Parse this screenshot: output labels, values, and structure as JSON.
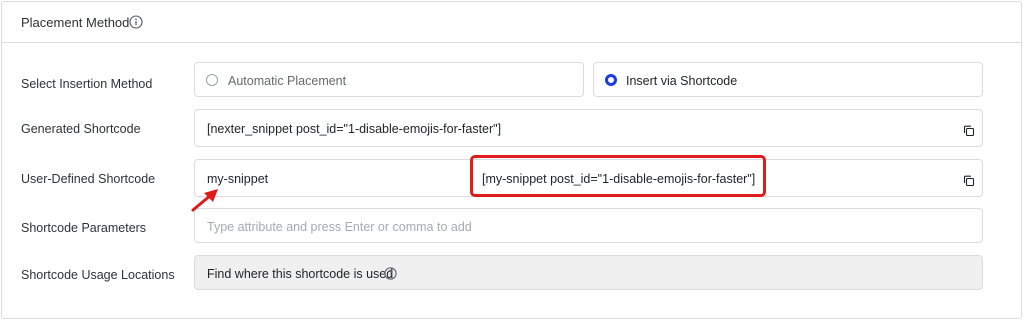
{
  "header": {
    "title": "Placement Method",
    "info_icon": "info-circle-icon"
  },
  "rows": {
    "insertion": {
      "label": "Select Insertion Method",
      "options": [
        {
          "label": "Automatic Placement",
          "selected": false
        },
        {
          "label": "Insert via Shortcode",
          "selected": true
        }
      ]
    },
    "generated": {
      "label": "Generated Shortcode",
      "value": "[nexter_snippet post_id=\"1-disable-emojis-for-faster\"]",
      "copy_icon": "copy-icon"
    },
    "user_defined": {
      "label": "User-Defined Shortcode",
      "value": "my-snippet",
      "preview": "[my-snippet post_id=\"1-disable-emojis-for-faster\"]",
      "copy_icon": "copy-icon"
    },
    "parameters": {
      "label": "Shortcode Parameters",
      "placeholder": "Type attribute and press Enter or comma to add",
      "value": ""
    },
    "usage": {
      "label": "Shortcode Usage Locations",
      "button_label": "Find where this shortcode is used",
      "help_icon": "question-circle-icon"
    }
  },
  "colors": {
    "accent": "#1a3ce8",
    "highlight": "#e01b1b",
    "border": "#dcdcde",
    "disabled_bg": "#f0f0f1"
  }
}
